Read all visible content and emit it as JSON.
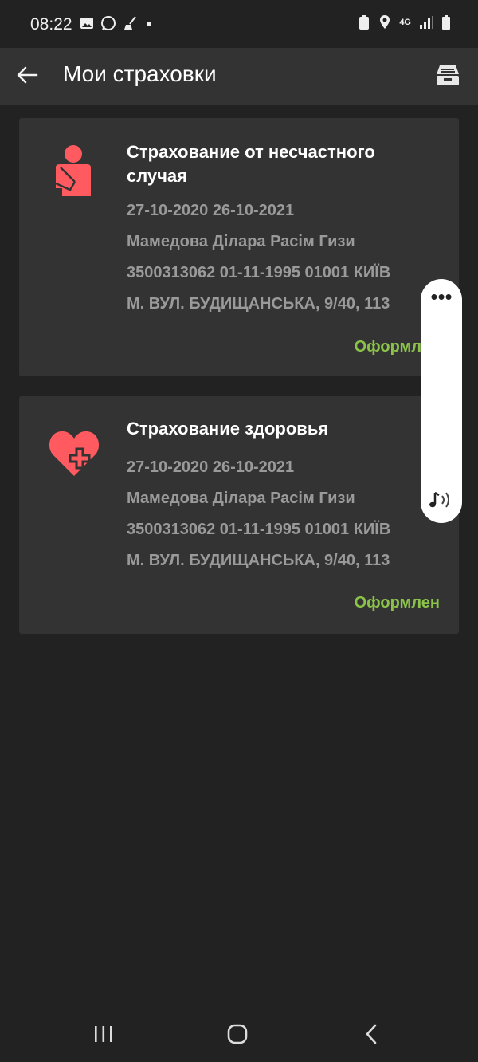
{
  "status_bar": {
    "time": "08:22",
    "left_icons": [
      "gallery-icon",
      "whatsapp-icon",
      "broom-icon",
      "dot-icon"
    ],
    "right_icons": [
      "battery-saver-icon",
      "location-icon",
      "4g-icon",
      "signal-icon",
      "battery-icon"
    ],
    "network": "4G"
  },
  "app_bar": {
    "title": "Мои страховки",
    "back_icon": "arrow-left-icon",
    "action_icon": "inbox-tray-icon"
  },
  "policies": [
    {
      "icon": "injured-person-icon",
      "title": "Страхование от несчастного случая",
      "dates": "27-10-2020 26-10-2021",
      "name": "Мамедова Ділара Расім Гизи",
      "id_line": "3500313062 01-11-1995 01001 КИЇВ",
      "address": "М. ВУЛ. БУДИЩАНСЬКА, 9/40, 113",
      "status": "Оформлен"
    },
    {
      "icon": "heart-plus-icon",
      "title": "Страхование здоровья",
      "dates": "27-10-2020 26-10-2021",
      "name": "Мамедова Ділара Расім Гизи",
      "id_line": "3500313062 01-11-1995 01001 КИЇВ",
      "address": "М. ВУЛ. БУДИЩАНСЬКА, 9/40, 113",
      "status": "Оформлен"
    }
  ],
  "floating_panel": {
    "menu_icon": "more-dots-icon",
    "sound_icon": "music-note-sound-icon"
  },
  "nav_bar": {
    "buttons": [
      "recent-apps-icon",
      "home-icon",
      "back-icon"
    ]
  },
  "colors": {
    "background": "#222222",
    "surface": "#333333",
    "accent_red": "#ff5a5f",
    "status_green": "#8bc34a",
    "secondary_text": "#9a9a9a"
  }
}
